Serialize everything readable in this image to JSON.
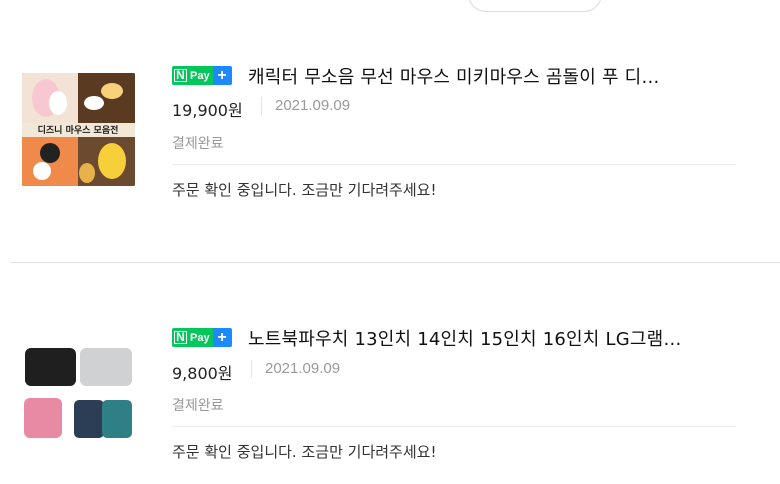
{
  "pay_badge": {
    "n": "N",
    "pay": "Pay",
    "plus": "+"
  },
  "orders": [
    {
      "title": "캐릭터 무소음 무선 마우스 미키마우스 곰돌이 푸 디…",
      "price": "19,900원",
      "date": "2021.09.09",
      "status": "결제완료",
      "message": "주문 확인 중입니다. 조금만 기다려주세요!",
      "thumb_caption": "디즈니 마우스 모음전"
    },
    {
      "title": "노트북파우치 13인치 14인치 15인치 16인치 LG그램…",
      "price": "9,800원",
      "date": "2021.09.09",
      "status": "결제완료",
      "message": "주문 확인 중입니다. 조금만 기다려주세요!"
    }
  ],
  "colors": {
    "naver_green": "#03c75a",
    "plus_blue": "#1e88ff"
  }
}
